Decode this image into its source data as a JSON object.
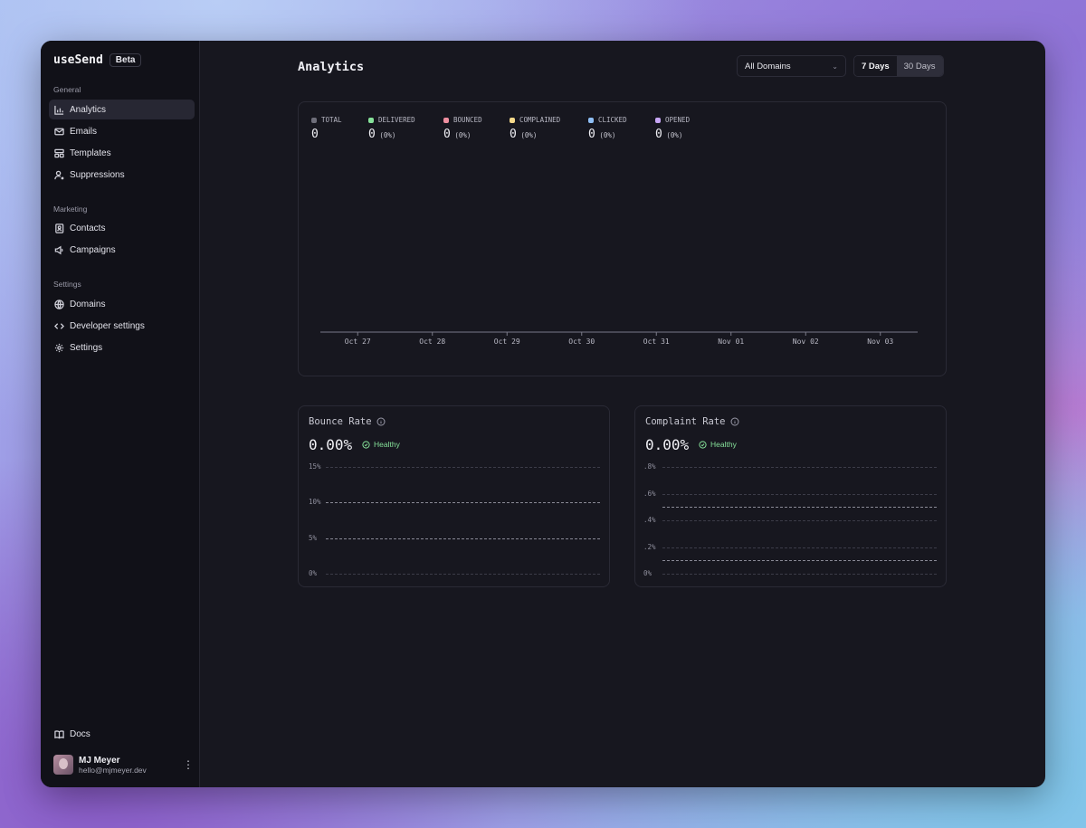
{
  "brand": {
    "name": "useSend",
    "badge": "Beta"
  },
  "sidebar": {
    "sections": [
      {
        "title": "General",
        "items": [
          {
            "label": "Analytics",
            "icon": "bar-chart-icon",
            "active": true
          },
          {
            "label": "Emails",
            "icon": "mail-icon"
          },
          {
            "label": "Templates",
            "icon": "template-icon"
          },
          {
            "label": "Suppressions",
            "icon": "user-x-icon"
          }
        ]
      },
      {
        "title": "Marketing",
        "items": [
          {
            "label": "Contacts",
            "icon": "contact-book-icon"
          },
          {
            "label": "Campaigns",
            "icon": "megaphone-icon"
          }
        ]
      },
      {
        "title": "Settings",
        "items": [
          {
            "label": "Domains",
            "icon": "globe-icon"
          },
          {
            "label": "Developer settings",
            "icon": "code-icon"
          },
          {
            "label": "Settings",
            "icon": "gear-icon"
          }
        ]
      }
    ],
    "docs": {
      "label": "Docs",
      "icon": "book-icon"
    },
    "user": {
      "name": "MJ Meyer",
      "email": "hello@mjmeyer.dev"
    }
  },
  "header": {
    "title": "Analytics",
    "domain_select": {
      "value": "All Domains"
    },
    "range": {
      "options": [
        "7 Days",
        "30 Days"
      ],
      "selected": "7 Days"
    }
  },
  "overview": {
    "stats": [
      {
        "label": "TOTAL",
        "value": "0",
        "pct": "",
        "color": "#6e6e7a"
      },
      {
        "label": "DELIVERED",
        "value": "0",
        "pct": "(0%)",
        "color": "#86e29a"
      },
      {
        "label": "BOUNCED",
        "value": "0",
        "pct": "(0%)",
        "color": "#ef8fa0"
      },
      {
        "label": "COMPLAINED",
        "value": "0",
        "pct": "(0%)",
        "color": "#f5d98a"
      },
      {
        "label": "CLICKED",
        "value": "0",
        "pct": "(0%)",
        "color": "#8fbff5"
      },
      {
        "label": "OPENED",
        "value": "0",
        "pct": "(0%)",
        "color": "#c7a6f5"
      }
    ]
  },
  "bounce_rate": {
    "title": "Bounce Rate",
    "value": "0.00%",
    "status": "Healthy"
  },
  "complaint_rate": {
    "title": "Complaint Rate",
    "value": "0.00%",
    "status": "Healthy"
  },
  "chart_data": [
    {
      "type": "bar",
      "categories": [
        "Oct 27",
        "Oct 28",
        "Oct 29",
        "Oct 30",
        "Oct 31",
        "Nov 01",
        "Nov 02",
        "Nov 03"
      ],
      "series": [
        {
          "name": "DELIVERED",
          "values": [
            0,
            0,
            0,
            0,
            0,
            0,
            0,
            0
          ]
        },
        {
          "name": "BOUNCED",
          "values": [
            0,
            0,
            0,
            0,
            0,
            0,
            0,
            0
          ]
        },
        {
          "name": "COMPLAINED",
          "values": [
            0,
            0,
            0,
            0,
            0,
            0,
            0,
            0
          ]
        },
        {
          "name": "CLICKED",
          "values": [
            0,
            0,
            0,
            0,
            0,
            0,
            0,
            0
          ]
        },
        {
          "name": "OPENED",
          "values": [
            0,
            0,
            0,
            0,
            0,
            0,
            0,
            0
          ]
        }
      ],
      "title": "",
      "xlabel": "",
      "ylabel": ""
    },
    {
      "type": "line",
      "title": "Bounce Rate",
      "y_ticks": [
        "15%",
        "10%",
        "5%",
        "0%"
      ],
      "ylim": [
        0,
        15
      ],
      "reference_lines": [
        10,
        5
      ],
      "grid": true
    },
    {
      "type": "line",
      "title": "Complaint Rate",
      "y_ticks": [
        ".8%",
        ".6%",
        ".4%",
        ".2%",
        "0%"
      ],
      "ylim": [
        0,
        0.8
      ],
      "reference_lines": [
        0.5,
        0.1
      ],
      "grid": true
    }
  ]
}
